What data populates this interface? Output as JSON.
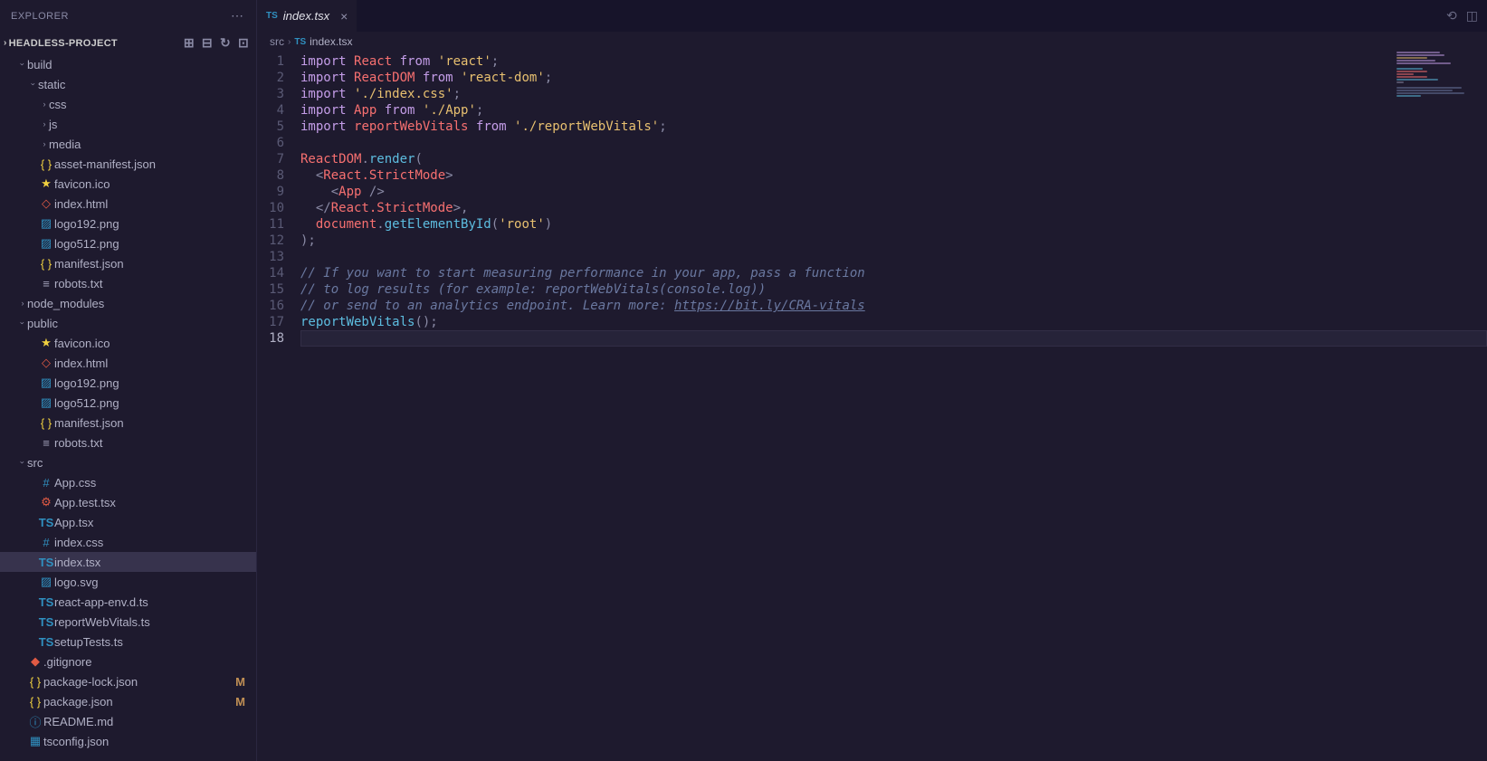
{
  "sidebar": {
    "title": "EXPLORER",
    "project": "HEADLESS-PROJECT",
    "tree": [
      {
        "type": "folder",
        "name": "build",
        "indent": 1,
        "open": true,
        "icon": "folder"
      },
      {
        "type": "folder",
        "name": "static",
        "indent": 2,
        "open": true,
        "icon": "folder"
      },
      {
        "type": "folder",
        "name": "css",
        "indent": 3,
        "open": false,
        "icon": "folder"
      },
      {
        "type": "folder",
        "name": "js",
        "indent": 3,
        "open": false,
        "icon": "folder"
      },
      {
        "type": "folder",
        "name": "media",
        "indent": 3,
        "open": false,
        "icon": "folder"
      },
      {
        "type": "file",
        "name": "asset-manifest.json",
        "indent": 2,
        "icon": "json"
      },
      {
        "type": "file",
        "name": "favicon.ico",
        "indent": 2,
        "icon": "star"
      },
      {
        "type": "file",
        "name": "index.html",
        "indent": 2,
        "icon": "html"
      },
      {
        "type": "file",
        "name": "logo192.png",
        "indent": 2,
        "icon": "img"
      },
      {
        "type": "file",
        "name": "logo512.png",
        "indent": 2,
        "icon": "img"
      },
      {
        "type": "file",
        "name": "manifest.json",
        "indent": 2,
        "icon": "json"
      },
      {
        "type": "file",
        "name": "robots.txt",
        "indent": 2,
        "icon": "txt"
      },
      {
        "type": "folder",
        "name": "node_modules",
        "indent": 1,
        "open": false,
        "icon": "folder"
      },
      {
        "type": "folder",
        "name": "public",
        "indent": 1,
        "open": true,
        "icon": "folder"
      },
      {
        "type": "file",
        "name": "favicon.ico",
        "indent": 2,
        "icon": "star"
      },
      {
        "type": "file",
        "name": "index.html",
        "indent": 2,
        "icon": "html"
      },
      {
        "type": "file",
        "name": "logo192.png",
        "indent": 2,
        "icon": "img"
      },
      {
        "type": "file",
        "name": "logo512.png",
        "indent": 2,
        "icon": "img"
      },
      {
        "type": "file",
        "name": "manifest.json",
        "indent": 2,
        "icon": "json"
      },
      {
        "type": "file",
        "name": "robots.txt",
        "indent": 2,
        "icon": "txt"
      },
      {
        "type": "folder",
        "name": "src",
        "indent": 1,
        "open": true,
        "icon": "folder"
      },
      {
        "type": "file",
        "name": "App.css",
        "indent": 2,
        "icon": "css"
      },
      {
        "type": "file",
        "name": "App.test.tsx",
        "indent": 2,
        "icon": "gear"
      },
      {
        "type": "file",
        "name": "App.tsx",
        "indent": 2,
        "icon": "ts"
      },
      {
        "type": "file",
        "name": "index.css",
        "indent": 2,
        "icon": "css"
      },
      {
        "type": "file",
        "name": "index.tsx",
        "indent": 2,
        "icon": "ts",
        "selected": true
      },
      {
        "type": "file",
        "name": "logo.svg",
        "indent": 2,
        "icon": "img"
      },
      {
        "type": "file",
        "name": "react-app-env.d.ts",
        "indent": 2,
        "icon": "ts"
      },
      {
        "type": "file",
        "name": "reportWebVitals.ts",
        "indent": 2,
        "icon": "ts"
      },
      {
        "type": "file",
        "name": "setupTests.ts",
        "indent": 2,
        "icon": "ts"
      },
      {
        "type": "file",
        "name": ".gitignore",
        "indent": 1,
        "icon": "git"
      },
      {
        "type": "file",
        "name": "package-lock.json",
        "indent": 1,
        "icon": "json",
        "badge": "M"
      },
      {
        "type": "file",
        "name": "package.json",
        "indent": 1,
        "icon": "json",
        "badge": "M"
      },
      {
        "type": "file",
        "name": "README.md",
        "indent": 1,
        "icon": "info"
      },
      {
        "type": "file",
        "name": "tsconfig.json",
        "indent": 1,
        "icon": "md"
      }
    ]
  },
  "tab": {
    "icon": "TS",
    "label": "index.tsx"
  },
  "breadcrumb": {
    "root": "src",
    "icon": "TS",
    "file": "index.tsx"
  },
  "code": {
    "lines": [
      {
        "n": 1,
        "html": "<span class='tk-kw'>import</span> <span class='tk-id'>React</span> <span class='tk-kw'>from</span> <span class='tk-str'>'react'</span><span class='tk-punc'>;</span>"
      },
      {
        "n": 2,
        "html": "<span class='tk-kw'>import</span> <span class='tk-id'>ReactDOM</span> <span class='tk-kw'>from</span> <span class='tk-str'>'react-dom'</span><span class='tk-punc'>;</span>"
      },
      {
        "n": 3,
        "html": "<span class='tk-kw'>import</span> <span class='tk-str'>'./index.css'</span><span class='tk-punc'>;</span>"
      },
      {
        "n": 4,
        "html": "<span class='tk-kw'>import</span> <span class='tk-id'>App</span> <span class='tk-kw'>from</span> <span class='tk-str'>'./App'</span><span class='tk-punc'>;</span>"
      },
      {
        "n": 5,
        "html": "<span class='tk-kw'>import</span> <span class='tk-id'>reportWebVitals</span> <span class='tk-kw'>from</span> <span class='tk-str'>'./reportWebVitals'</span><span class='tk-punc'>;</span>"
      },
      {
        "n": 6,
        "html": ""
      },
      {
        "n": 7,
        "html": "<span class='tk-id'>ReactDOM</span><span class='tk-punc'>.</span><span class='tk-func'>render</span><span class='tk-punc'>(</span>"
      },
      {
        "n": 8,
        "html": "  <span class='tk-punc'>&lt;</span><span class='tk-tag'>React.StrictMode</span><span class='tk-punc'>&gt;</span>"
      },
      {
        "n": 9,
        "html": "    <span class='tk-punc'>&lt;</span><span class='tk-tag'>App</span> <span class='tk-punc'>/&gt;</span>"
      },
      {
        "n": 10,
        "html": "  <span class='tk-punc'>&lt;/</span><span class='tk-tag'>React.StrictMode</span><span class='tk-punc'>&gt;,</span>"
      },
      {
        "n": 11,
        "html": "  <span class='tk-id'>document</span><span class='tk-punc'>.</span><span class='tk-func'>getElementById</span><span class='tk-punc'>(</span><span class='tk-str'>'root'</span><span class='tk-punc'>)</span>"
      },
      {
        "n": 12,
        "html": "<span class='tk-punc'>);</span>"
      },
      {
        "n": 13,
        "html": ""
      },
      {
        "n": 14,
        "html": "<span class='tk-comment'>// If you want to start measuring performance in your app, pass a function</span>"
      },
      {
        "n": 15,
        "html": "<span class='tk-comment'>// to log results (for example: reportWebVitals(console.log))</span>"
      },
      {
        "n": 16,
        "html": "<span class='tk-comment'>// or send to an analytics endpoint. Learn more: </span><span class='tk-link'>https://bit.ly/CRA-vitals</span>"
      },
      {
        "n": 17,
        "html": "<span class='tk-func'>reportWebVitals</span><span class='tk-punc'>();</span>"
      },
      {
        "n": 18,
        "html": "",
        "cursor": true
      }
    ]
  },
  "icons": {
    "folder": "⏷",
    "folder-closed": "›",
    "json": "{}",
    "star": "★",
    "html": "◇",
    "img": "▨",
    "txt": "≡",
    "ts": "TS",
    "css": "#",
    "gear": "⚙",
    "git": "◆",
    "info": "ⓘ",
    "md": "▦"
  }
}
